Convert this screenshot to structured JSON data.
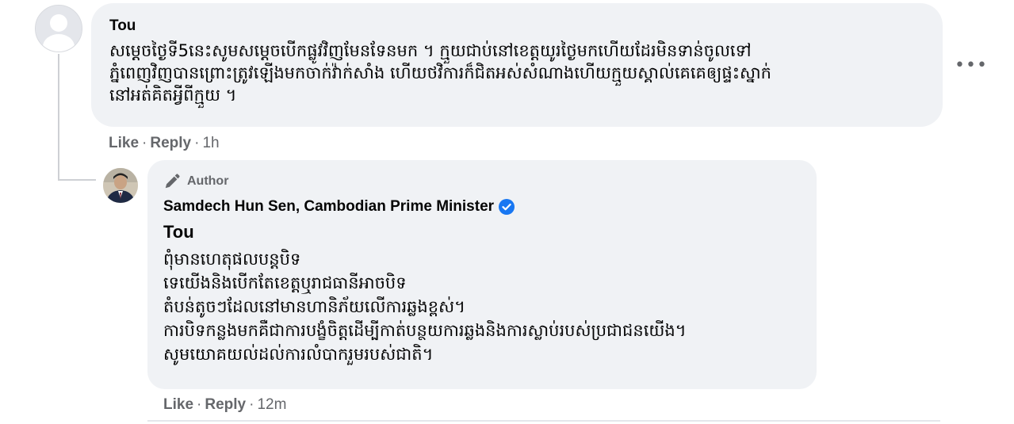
{
  "comment": {
    "author": "Tou",
    "lines": [
      "សម្តេចថ្ងៃទី5នេះសូមសម្តេចបើកផ្លូវវិញមែនទែនមក ។ ក្មួយជាប់នៅខេត្តយូរថ្ងៃមកហើយដែរមិនទាន់ចូលទៅ",
      "ភ្នំពេញវិញបានព្រោះត្រូវឡើងមកចាក់វ៉ាក់សាំង ហើយថវិការក៏ជិតអស់សំណាងហើយក្មួយស្គាល់គេគេឲ្យផ្ទះស្នាក់",
      "នៅអត់គិតអ្វីពីក្មួយ ។"
    ],
    "actions": {
      "like": "Like",
      "reply": "Reply",
      "sep": "·",
      "time": "1h"
    },
    "more_icon": "more-horizontal-icon"
  },
  "reply": {
    "badge": "Author",
    "name": "Samdech Hun Sen, Cambodian Prime Minister",
    "verified_icon": "verified-badge-icon",
    "mention": "Tou",
    "lines": [
      "ពុំមានហេតុផលបន្តបិទ",
      "ទេយើងនិងបើកតែខេត្តឬរាជធានីអាចបិទ",
      "តំបន់តូចៗដែលនៅមានហានិភ័យលើការឆ្លងខ្ពស់។",
      "ការបិទកន្លងមកគឺជាការបង្ខំចិត្តដើម្បីកាត់បន្ថយការឆ្លងនិងការស្លាប់របស់ប្រជាជនយើង។",
      "សូមយោគយល់ដល់ការលំបាករួមរបស់ជាតិ។"
    ],
    "actions": {
      "like": "Like",
      "reply": "Reply",
      "sep": "·",
      "time": "12m"
    }
  },
  "colors": {
    "bubble": "#f0f2f5",
    "secondary_text": "#65676b",
    "verified": "#1877f2"
  }
}
